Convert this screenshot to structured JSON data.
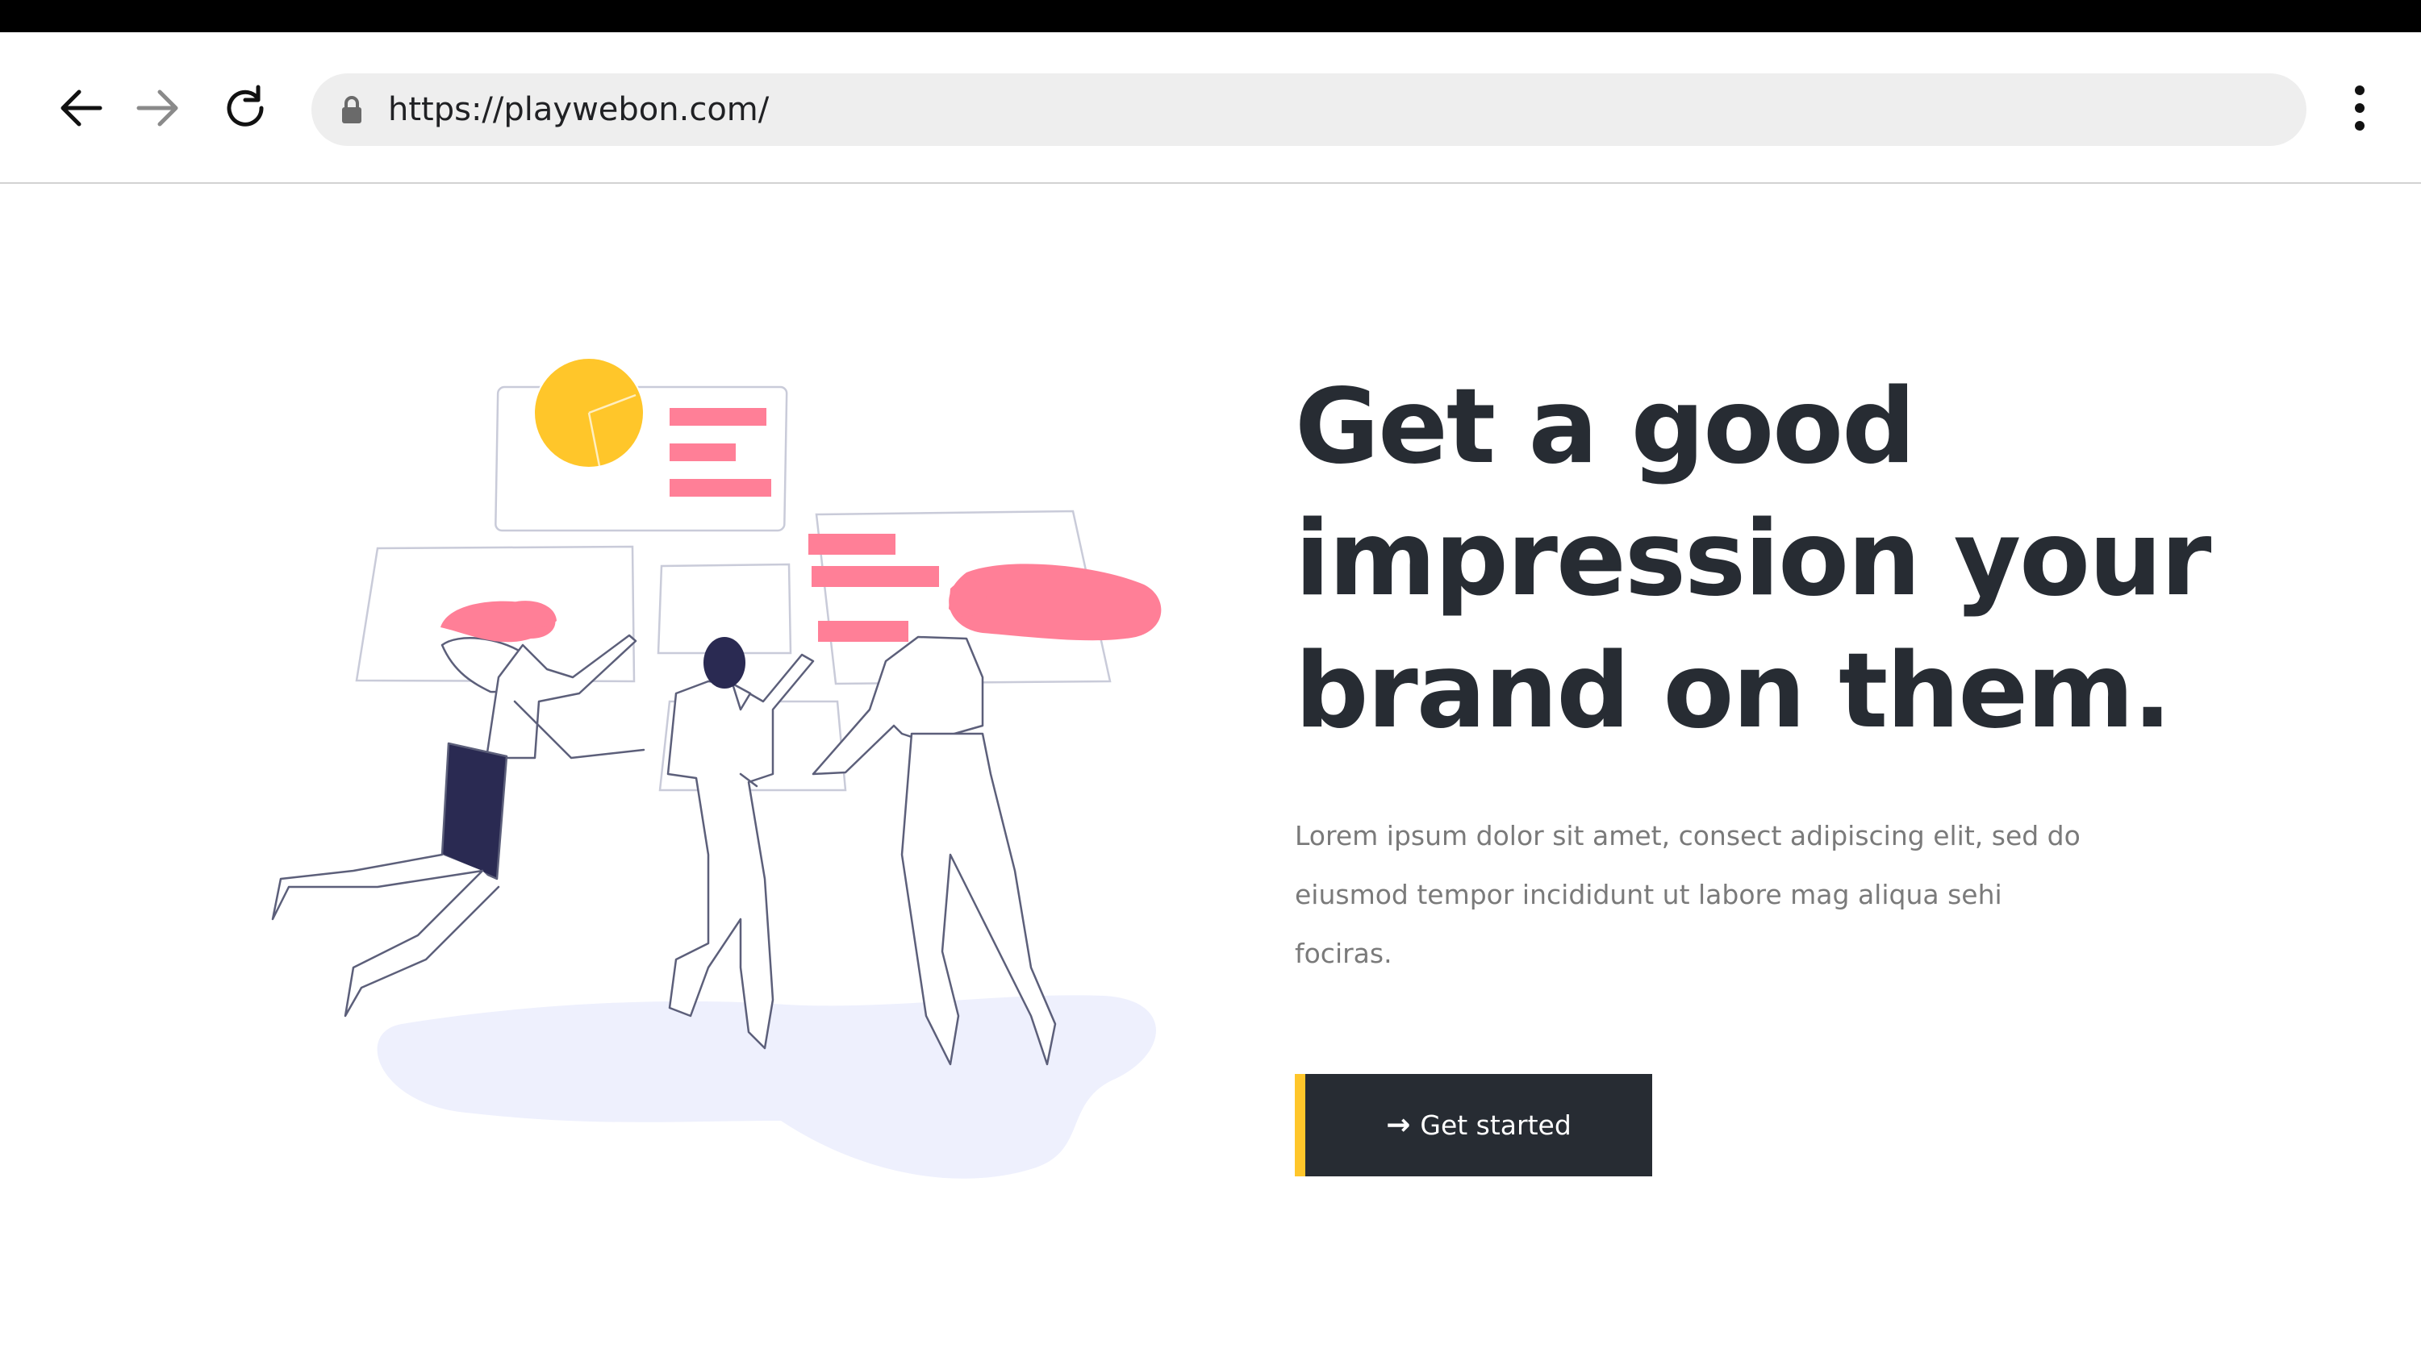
{
  "browser": {
    "url": "https://playwebon.com/",
    "icons": {
      "back": "arrow-left-icon",
      "forward": "arrow-right-icon",
      "reload": "reload-icon",
      "secure": "lock-icon",
      "menu": "more-vertical-icon"
    }
  },
  "hero": {
    "title": "Get a good impression your brand on them.",
    "text": "Lorem ipsum dolor sit amet, consect adipiscing elit, sed do eiusmod tempor incididunt ut labore mag aliqua sehi fociras.",
    "cta_label": "Get started",
    "cta_icon": "arrow-right-icon"
  },
  "colors": {
    "heading": "#272c33",
    "body_text": "#7a7a7a",
    "button_bg": "#272c33",
    "button_accent": "#ffc62a",
    "illustration_pink": "#ff7f97",
    "illustration_yellow": "#ffc62a",
    "illustration_navy": "#2a2a52"
  }
}
